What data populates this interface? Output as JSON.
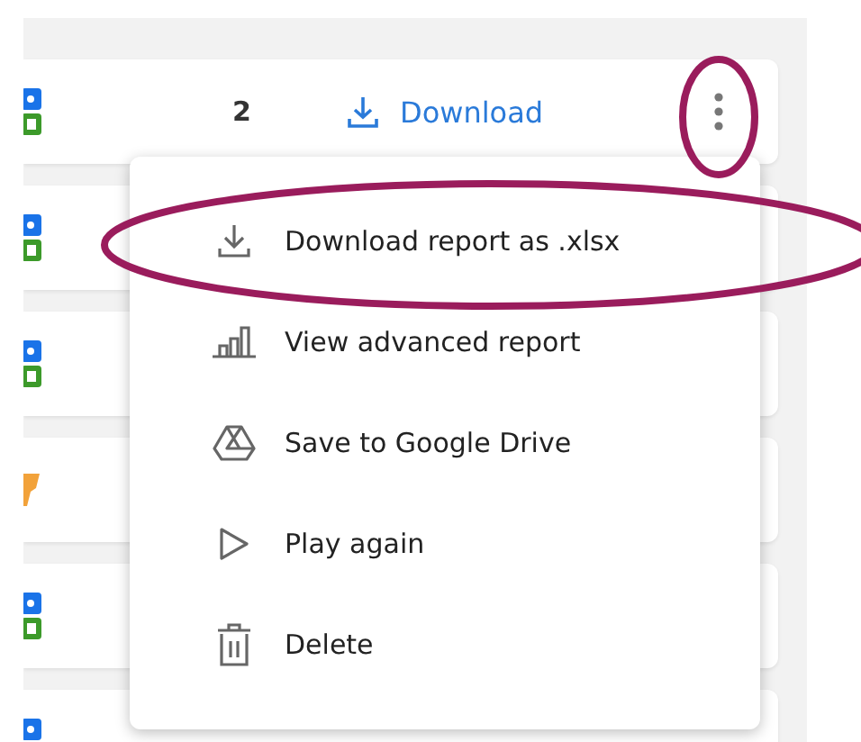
{
  "rows": [
    {
      "kind": "blocks",
      "count": "2",
      "action": "Download"
    },
    {
      "kind": "blocks"
    },
    {
      "kind": "blocks"
    },
    {
      "kind": "trophy"
    },
    {
      "kind": "blocks"
    },
    {
      "kind": "blocks"
    }
  ],
  "menu": {
    "open": true,
    "items": [
      {
        "kind": "download",
        "label": "Download report as .xlsx"
      },
      {
        "kind": "chart",
        "label": "View advanced report"
      },
      {
        "kind": "drive",
        "label": "Save to Google Drive"
      },
      {
        "kind": "play",
        "label": "Play again"
      },
      {
        "kind": "delete",
        "label": "Delete"
      }
    ]
  }
}
